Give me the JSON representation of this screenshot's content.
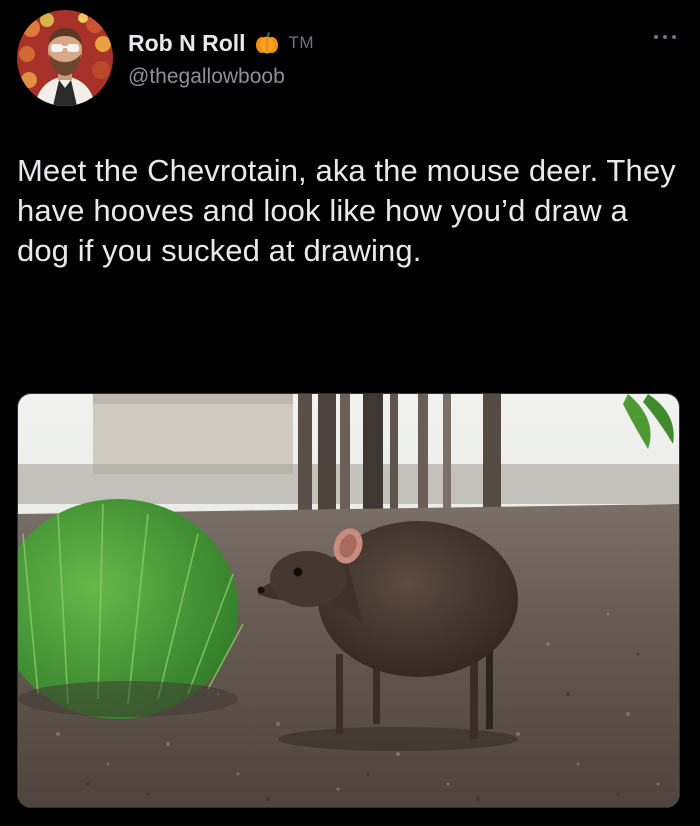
{
  "author": {
    "display_name": "Rob N Roll",
    "name_emoji": "pumpkin-icon",
    "name_suffix": "TM",
    "handle": "@thegallowboob",
    "avatar": "profile photo of bearded man with sunglasses"
  },
  "menu": {
    "icon": "more-horizontal-icon"
  },
  "tweet": {
    "text": "Meet the Chevrotain, aka the mouse deer. They have hooves and look like how you’d draw a dog if you sucked at drawing."
  },
  "media": {
    "subject": "Chevrotain (mouse deer) standing on dirt next to green grass tuft"
  },
  "colors": {
    "background": "#000000",
    "text": "#e7e9ea",
    "secondary_text": "#8b9197",
    "pumpkin": "#f4900c"
  }
}
